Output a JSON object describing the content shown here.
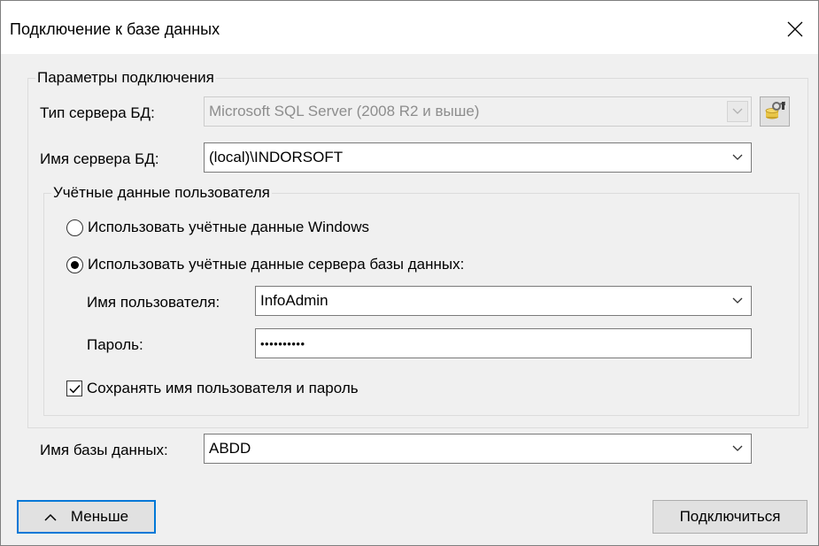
{
  "window": {
    "title": "Подключение к базе данных"
  },
  "connection": {
    "group_label": "Параметры подключения",
    "server_type_label": "Тип сервера БД:",
    "server_type_value": "Microsoft SQL Server (2008 R2 и выше)",
    "server_name_label": "Имя сервера БД:",
    "server_name_value": "(local)\\INDORSOFT"
  },
  "credentials": {
    "group_label": "Учётные данные пользователя",
    "windows_auth_label": "Использовать учётные данные Windows",
    "server_auth_label": "Использовать учётные данные сервера базы данных:",
    "username_label": "Имя пользователя:",
    "username_value": "InfoAdmin",
    "password_label": "Пароль:",
    "password_value": "••••••••••",
    "save_label": "Сохранять имя пользователя и пароль"
  },
  "database": {
    "name_label": "Имя базы данных:",
    "name_value": "ABDD"
  },
  "buttons": {
    "less_label": "Меньше",
    "connect_label": "Подключиться"
  }
}
